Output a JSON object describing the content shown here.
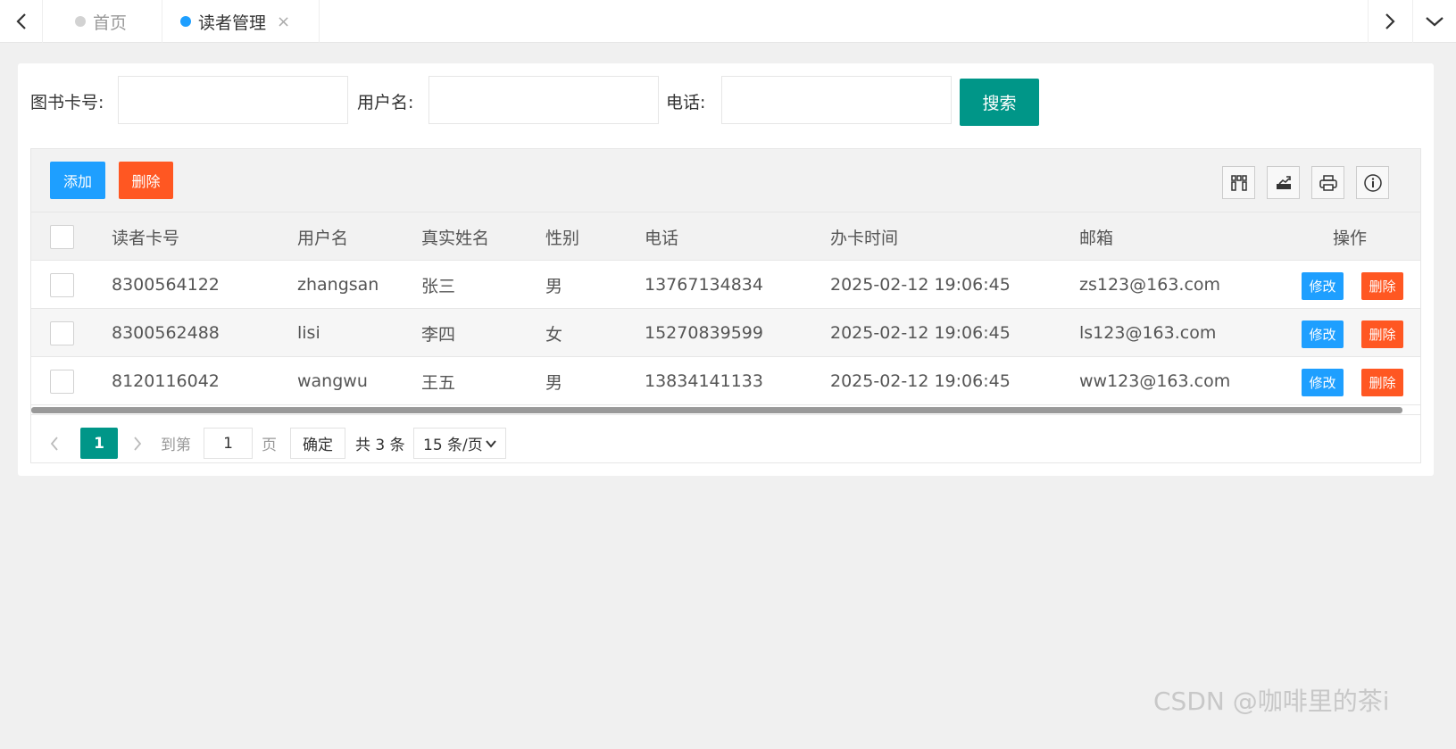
{
  "tabs": {
    "home_label": "首页",
    "active_label": "读者管理",
    "close_glyph": "×"
  },
  "search": {
    "card_label": "图书卡号:",
    "username_label": "用户名:",
    "phone_label": "电话:",
    "card_value": "",
    "username_value": "",
    "phone_value": "",
    "button_label": "搜索"
  },
  "toolbar": {
    "add_label": "添加",
    "delete_label": "删除",
    "icons": [
      "columns-icon",
      "export-icon",
      "print-icon",
      "info-icon"
    ]
  },
  "table": {
    "columns": [
      "读者卡号",
      "用户名",
      "真实姓名",
      "性别",
      "电话",
      "办卡时间",
      "邮箱",
      "操作"
    ],
    "rows": [
      {
        "card": "8300564122",
        "username": "zhangsan",
        "name": "张三",
        "gender": "男",
        "phone": "13767134834",
        "time": "2025-02-12 19:06:45",
        "email": "zs123@163.com",
        "edit": "修改",
        "del": "删除"
      },
      {
        "card": "8300562488",
        "username": "lisi",
        "name": "李四",
        "gender": "女",
        "phone": "15270839599",
        "time": "2025-02-12 19:06:45",
        "email": "ls123@163.com",
        "edit": "修改",
        "del": "删除"
      },
      {
        "card": "8120116042",
        "username": "wangwu",
        "name": "王五",
        "gender": "男",
        "phone": "13834141133",
        "time": "2025-02-12 19:06:45",
        "email": "ww123@163.com",
        "edit": "修改",
        "del": "删除"
      }
    ]
  },
  "pager": {
    "current_page": "1",
    "goto_label": "到第",
    "goto_value": "1",
    "page_unit": "页",
    "confirm_label": "确定",
    "total_label": "共 3 条",
    "page_size": "15 条/页"
  },
  "watermark": "CSDN @咖啡里的茶i",
  "colors": {
    "primary": "#009688",
    "blue": "#1e9fff",
    "danger": "#ff5722"
  }
}
